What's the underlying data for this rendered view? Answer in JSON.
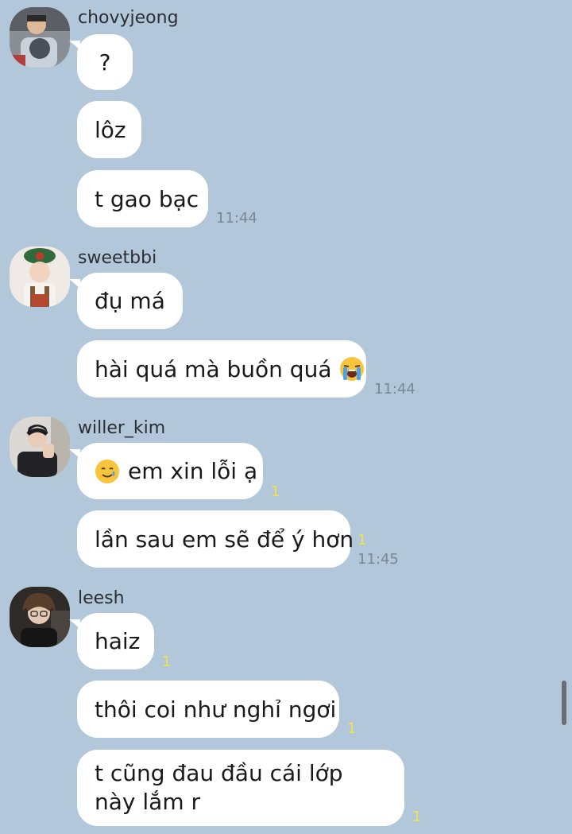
{
  "messages": [
    {
      "sender": "chovyjeong",
      "avatar": "chovyjeong-avatar",
      "bubbles": [
        "?",
        "lôz",
        "t gao bạc"
      ],
      "time": "11:44"
    },
    {
      "sender": "sweetbbi",
      "avatar": "sweetbbi-avatar",
      "bubbles": [
        "đụ má",
        "hài quá mà buồn quá"
      ],
      "emoji": "loudly-crying-face-emoji",
      "time": "11:44"
    },
    {
      "sender": "willer_kim",
      "avatar": "willer-kim-avatar",
      "bubbles": [
        "em xin lỗi ạ",
        "lần sau em sẽ để ý hơn"
      ],
      "emoji": "smiling-face-with-tear-emoji",
      "unread": [
        "1",
        "1"
      ],
      "time": "11:45"
    },
    {
      "sender": "leesh",
      "avatar": "leesh-avatar",
      "bubbles": [
        "haiz",
        "thôi coi như nghỉ ngơi",
        "t cũng đau đầu cái lớp này lắm r"
      ],
      "unread": [
        "1",
        "1",
        "1"
      ]
    }
  ],
  "colors": {
    "background": "#b2c7da",
    "bubble": "#ffffff",
    "unread": "#f3e34a",
    "time": "#7b8792"
  }
}
